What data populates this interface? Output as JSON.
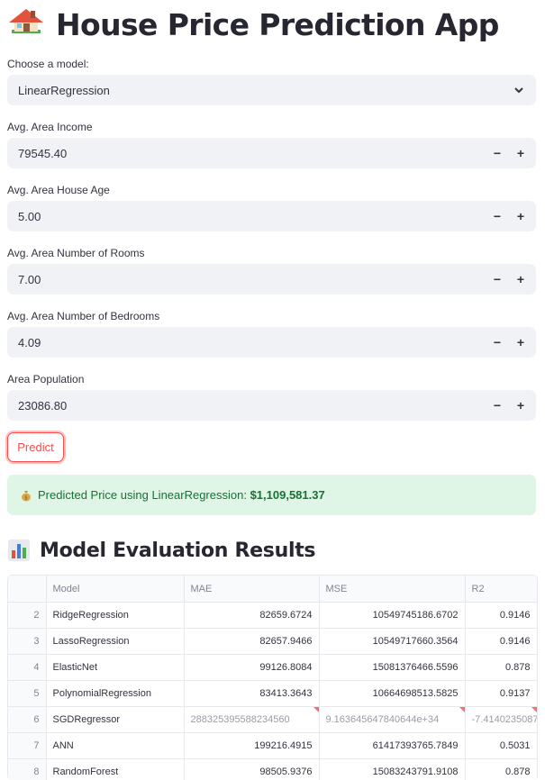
{
  "app": {
    "title": "House Price Prediction App",
    "title_icon": "house-emoji-icon"
  },
  "model_select": {
    "label": "Choose a model:",
    "value": "LinearRegression"
  },
  "inputs": [
    {
      "label": "Avg. Area Income",
      "value": "79545.40"
    },
    {
      "label": "Avg. Area House Age",
      "value": "5.00"
    },
    {
      "label": "Avg. Area Number of Rooms",
      "value": "7.00"
    },
    {
      "label": "Avg. Area Number of Bedrooms",
      "value": "4.09"
    },
    {
      "label": "Area Population",
      "value": "23086.80"
    }
  ],
  "stepper": {
    "minus": "−",
    "plus": "+"
  },
  "predict_button": "Predict",
  "result": {
    "prefix": "Predicted Price using LinearRegression: ",
    "price": "$1,109,581.37",
    "icon": "money-bag-icon",
    "color": "#177233",
    "background": "#dff5e6"
  },
  "evaluation": {
    "heading": "Model Evaluation Results",
    "icon": "bar-chart-icon",
    "columns": [
      "",
      "Model",
      "MAE",
      "MSE",
      "R2"
    ],
    "rows": [
      {
        "idx": "2",
        "model": "RidgeRegression",
        "mae": "82659.6724",
        "mse": "10549745186.6702",
        "r2": "0.9146"
      },
      {
        "idx": "3",
        "model": "LassoRegression",
        "mae": "82657.9466",
        "mse": "10549717660.3564",
        "r2": "0.9146"
      },
      {
        "idx": "4",
        "model": "ElasticNet",
        "mae": "99126.8084",
        "mse": "15081376466.5596",
        "r2": "0.878"
      },
      {
        "idx": "5",
        "model": "PolynomialRegression",
        "mae": "83413.3643",
        "mse": "10664698513.5825",
        "r2": "0.9137"
      },
      {
        "idx": "6",
        "model": "SGDRegressor",
        "mae": "288325395588234560",
        "mse": "9.163645647840644e+34",
        "r2": "-7.4140235087"
      },
      {
        "idx": "7",
        "model": "ANN",
        "mae": "199216.4915",
        "mse": "61417393765.7849",
        "r2": "0.5031"
      },
      {
        "idx": "8",
        "model": "RandomForest",
        "mae": "98505.9376",
        "mse": "15083243791.9108",
        "r2": "0.878"
      }
    ]
  },
  "colors": {
    "accent": "#ff4b4b",
    "input_bg": "#f0f2f6"
  }
}
